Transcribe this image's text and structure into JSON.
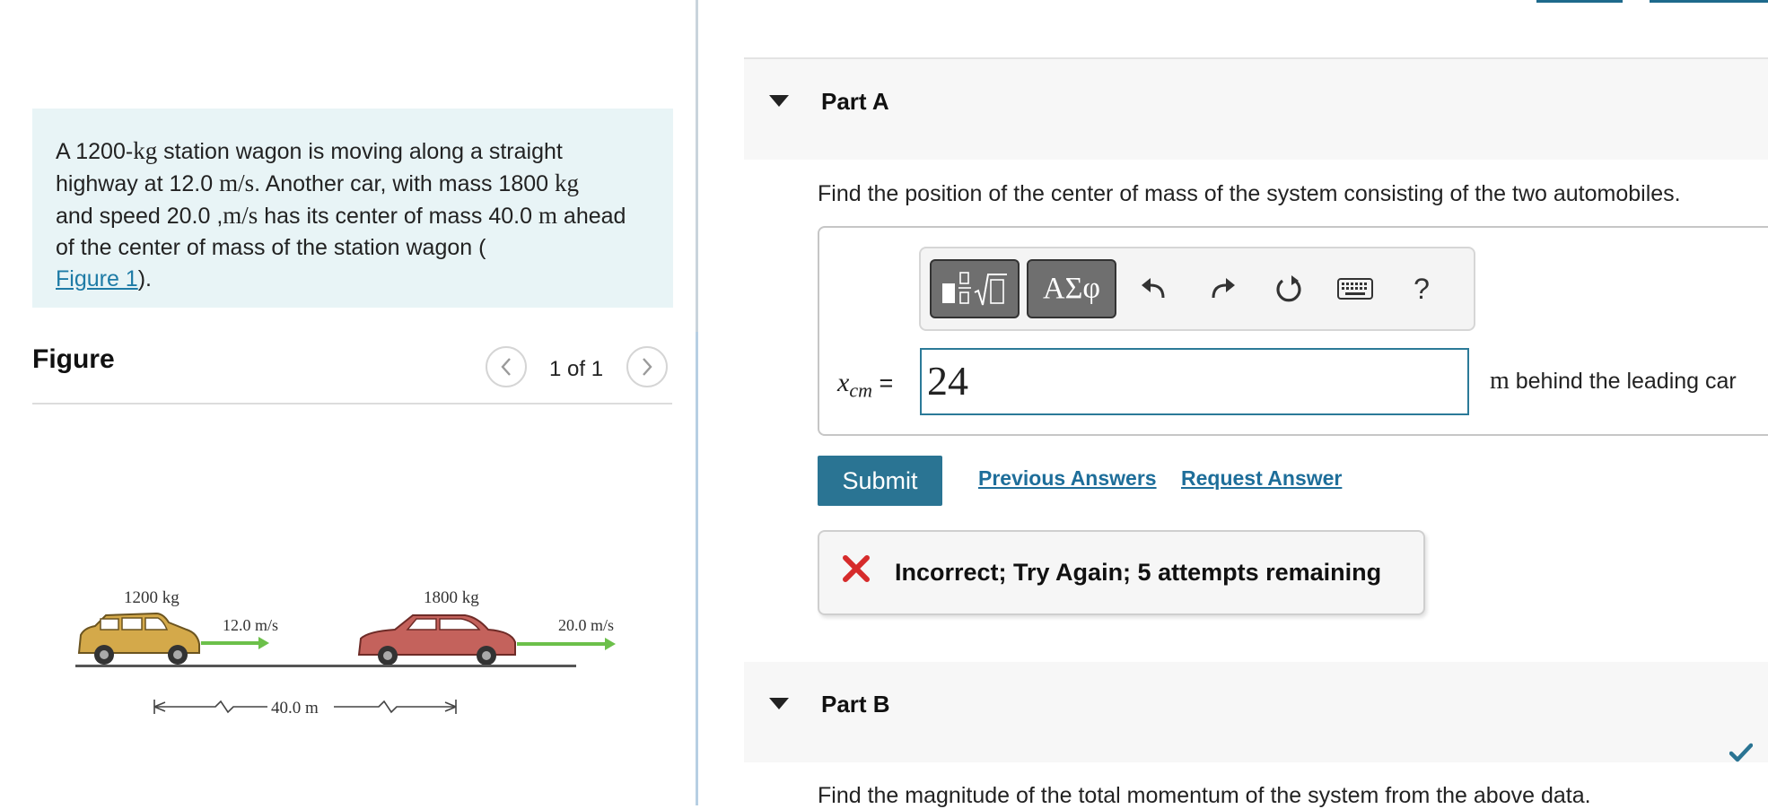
{
  "problem": {
    "text_1": "A 1200-",
    "unit_kg_1": "kg",
    "text_2": " station wagon is moving along a straight highway at 12.0 ",
    "unit_ms_1": "m/s",
    "text_3": ". Another car, with mass 1800 ",
    "unit_kg_2": "kg",
    "text_4": " and speed 20.0 ,",
    "unit_ms_2": "m/s",
    "text_5": " has its center of mass 40.0 ",
    "unit_m": "m",
    "text_6": " ahead of the center of mass of the station wagon (",
    "figure_link": "Figure 1",
    "text_7": ")."
  },
  "figure": {
    "title": "Figure",
    "pager": "1 of 1",
    "prev_glyph": "<",
    "next_glyph": ">",
    "wagon_mass": "1200 kg",
    "wagon_speed": "12.0 m/s",
    "sedan_mass": "1800 kg",
    "sedan_speed": "20.0 m/s",
    "distance": "40.0 m",
    "colors": {
      "wagon": "#d4a94a",
      "sedan": "#c4625c",
      "arrow": "#6cc04a"
    }
  },
  "partA": {
    "title": "Part A",
    "question": "Find the position of the center of mass of the system consisting of the two automobiles.",
    "toolbar": {
      "symbols_label": "ΑΣφ",
      "help_label": "?"
    },
    "equation_var": "x",
    "equation_sub": "cm",
    "equation_eq": "=",
    "answer_value": "24",
    "unit_m": "m",
    "unit_text": " behind the leading car",
    "submit_label": "Submit",
    "previous_answers_label": "Previous Answers",
    "request_answer_label": "Request Answer",
    "feedback": "Incorrect; Try Again; 5 attempts remaining"
  },
  "partB": {
    "title": "Part B",
    "question": "Find the magnitude of the total momentum of the system from the above data."
  },
  "colors": {
    "accent": "#2a7493",
    "problem_bg": "#e8f4f6",
    "error": "#d62b2b",
    "success": "#2a7493"
  }
}
